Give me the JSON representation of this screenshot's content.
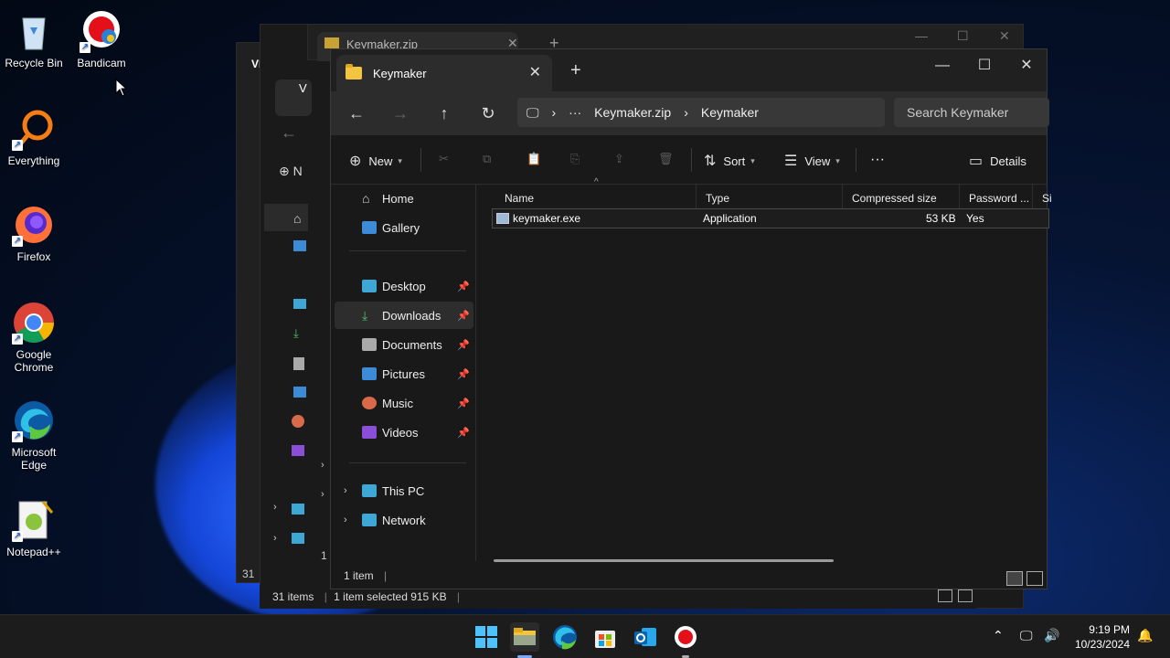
{
  "desktop": {
    "icons": [
      {
        "label": "Recycle Bin"
      },
      {
        "label": "Bandicam"
      },
      {
        "label": "Everything"
      },
      {
        "label": "Firefox"
      },
      {
        "label": "Google Chrome"
      },
      {
        "label": "Microsoft Edge"
      },
      {
        "label": "Notepad++"
      }
    ]
  },
  "background_windows": {
    "tab_title": "Keymaker.zip",
    "left_title": "VRCAF",
    "left_tab": "V",
    "new_letter": "N",
    "status_items": "31 items",
    "status_selected": "1 item selected  915 KB",
    "mini_count_left": "31",
    "mini_count_mid": "1"
  },
  "explorer": {
    "tab_title": "Keymaker",
    "breadcrumb": {
      "ellipsis": "···",
      "parent": "Keymaker.zip",
      "current": "Keymaker"
    },
    "search_placeholder": "Search Keymaker",
    "commands": {
      "new": "New",
      "sort": "Sort",
      "view": "View",
      "more": "···",
      "details": "Details"
    },
    "nav": {
      "home": "Home",
      "gallery": "Gallery",
      "desktop": "Desktop",
      "downloads": "Downloads",
      "documents": "Documents",
      "pictures": "Pictures",
      "music": "Music",
      "videos": "Videos",
      "this_pc": "This PC",
      "network": "Network"
    },
    "columns": {
      "name": "Name",
      "type": "Type",
      "compressed_size": "Compressed size",
      "password": "Password ...",
      "size": "Si"
    },
    "files": [
      {
        "name": "keymaker.exe",
        "type": "Application",
        "compressed_size": "53 KB",
        "password": "Yes"
      }
    ],
    "status": "1 item"
  },
  "taskbar": {
    "time": "9:19 PM",
    "date": "10/23/2024"
  },
  "colors": {
    "accent": "#4cc2ff",
    "folder": "#f3c440",
    "taskbar": "#1c1c1c"
  }
}
